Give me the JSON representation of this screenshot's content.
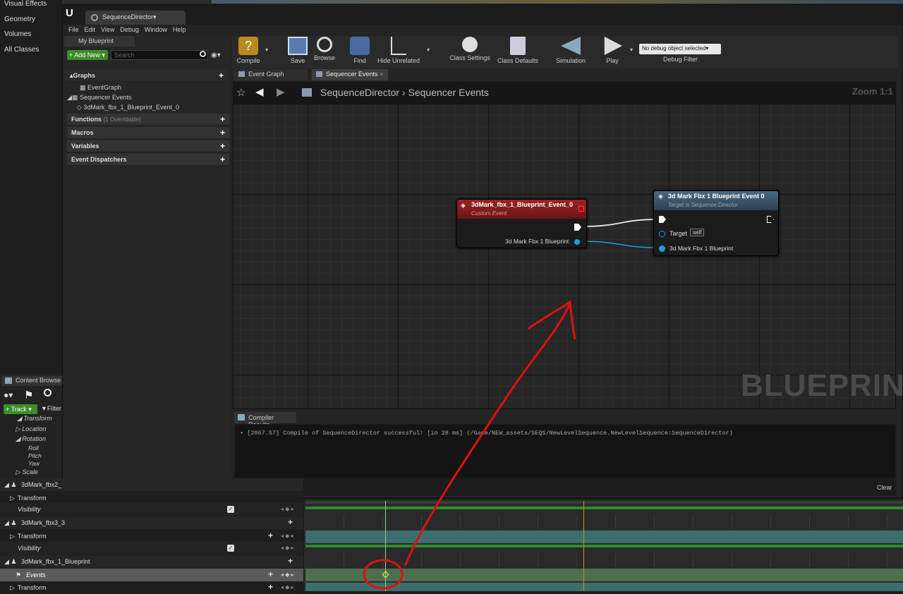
{
  "left_menu": [
    "Visual Effects",
    "Geometry",
    "Volumes",
    "All Classes"
  ],
  "window": {
    "tab_title": "SequenceDirector",
    "menu": [
      "File",
      "Edit",
      "View",
      "Debug",
      "Window",
      "Help"
    ]
  },
  "my_blueprint": {
    "header": "My Blueprint",
    "add_new": "+ Add New",
    "search_placeholder": "Search",
    "graphs_label": "Graphs",
    "event_graph": "EventGraph",
    "sequencer_events": "Sequencer Events",
    "event_item": "3dMark_fbx_1_Blueprint_Event_0",
    "functions_label": "Functions",
    "functions_note": "(1 Overridable)",
    "macros_label": "Macros",
    "variables_label": "Variables",
    "dispatchers_label": "Event Dispatchers"
  },
  "toolbar": {
    "compile": "Compile",
    "save": "Save",
    "browse": "Browse",
    "find": "Find",
    "hide_unrelated": "Hide Unrelated",
    "class_settings": "Class Settings",
    "class_defaults": "Class Defaults",
    "simulation": "Simulation",
    "play": "Play",
    "debug_select": "No debug object selected",
    "debug_filter": "Debug Filter"
  },
  "graph_tabs": [
    "Event Graph",
    "Sequencer Events"
  ],
  "breadcrumb": {
    "root": "SequenceDirector",
    "current": "Sequencer Events",
    "zoom": "Zoom 1:1"
  },
  "node_event": {
    "title": "3dMark_fbx_1_Blueprint_Event_0",
    "subtitle": "Custom Event",
    "output_pin": "3d Mark Fbx 1 Blueprint"
  },
  "node_call": {
    "title": "3d Mark Fbx 1 Blueprint Event 0",
    "subtitle": "Target is Sequence Director",
    "target_pin": "Target",
    "target_value": "self",
    "input_pin": "3d Mark Fbx 1 Blueprint"
  },
  "watermark": "BLUEPRINT",
  "compiler": {
    "tab": "Compiler Results",
    "message": "[2867.57] Compile of SequenceDirector successful! [in 28 ms] (/Game/NEW_assets/SEQS/NewLevelSequence.NewLevelSequence:SequenceDirector)",
    "clear": "Clear"
  },
  "content_browser": "Content Browse",
  "sequencer": {
    "track_btn": "+ Track",
    "filter": "Filter",
    "rows": [
      {
        "label": "Transform",
        "indent": "t1"
      },
      {
        "label": "Location",
        "indent": "t2"
      },
      {
        "label": "Rotation",
        "indent": "t2"
      },
      {
        "label": "Roll",
        "indent": "t3"
      },
      {
        "label": "Pitch",
        "indent": "t3"
      },
      {
        "label": "Yaw",
        "indent": "t3"
      },
      {
        "label": "Scale",
        "indent": "t2"
      }
    ],
    "tracks": [
      {
        "label": "3dMark_fbx2_"
      },
      {
        "label": "Transform"
      },
      {
        "label": "Visibility"
      },
      {
        "label": "3dMark_fbx3_3"
      },
      {
        "label": "Transform"
      },
      {
        "label": "Visibility"
      },
      {
        "label": "3dMark_fbx_1_Blueprint"
      },
      {
        "label": "Events"
      },
      {
        "label": "Transform"
      }
    ]
  },
  "colors": {
    "event_header": "#8a1f1f",
    "call_header": "#3d5a70",
    "annotation": "#e01010"
  }
}
